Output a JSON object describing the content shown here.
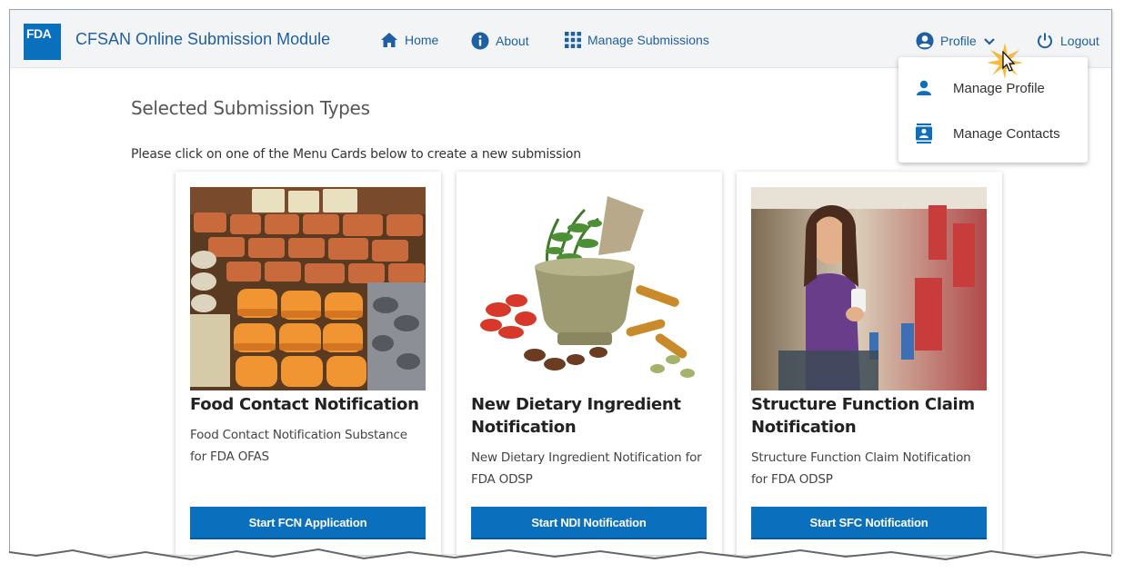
{
  "header": {
    "logo_text": "FDA",
    "app_title": "CFSAN Online Submission Module",
    "nav": [
      {
        "label": "Home",
        "icon": "home-icon"
      },
      {
        "label": "About",
        "icon": "info-icon"
      },
      {
        "label": "Manage Submissions",
        "icon": "grid-icon"
      }
    ],
    "profile_label": "Profile",
    "logout_label": "Logout"
  },
  "profile_menu": {
    "items": [
      {
        "label": "Manage Profile",
        "icon": "person-icon"
      },
      {
        "label": "Manage Contacts",
        "icon": "contacts-icon"
      }
    ]
  },
  "main": {
    "section_title": "Selected Submission Types",
    "instructions": "Please click on one of the Menu Cards below to create a new submission",
    "cards": [
      {
        "title": "Food Contact Notification",
        "description": "Food Contact Notification Substance for FDA OFAS",
        "button": "Start FCN Application",
        "image": "packaged-cheese-photo"
      },
      {
        "title": "New Dietary Ingredient Notification",
        "description": "New Dietary Ingredient Notification for FDA ODSP",
        "button": "Start NDI Notification",
        "image": "mortar-and-spices-photo"
      },
      {
        "title": "Structure Function Claim Notification",
        "description": "Structure Function Claim Notification for FDA ODSP",
        "button": "Start SFC Notification",
        "image": "woman-in-store-photo"
      }
    ]
  },
  "colors": {
    "brand_blue": "#0a70bd",
    "link_blue": "#1f5fa3",
    "header_bg": "#f3f4f6"
  }
}
